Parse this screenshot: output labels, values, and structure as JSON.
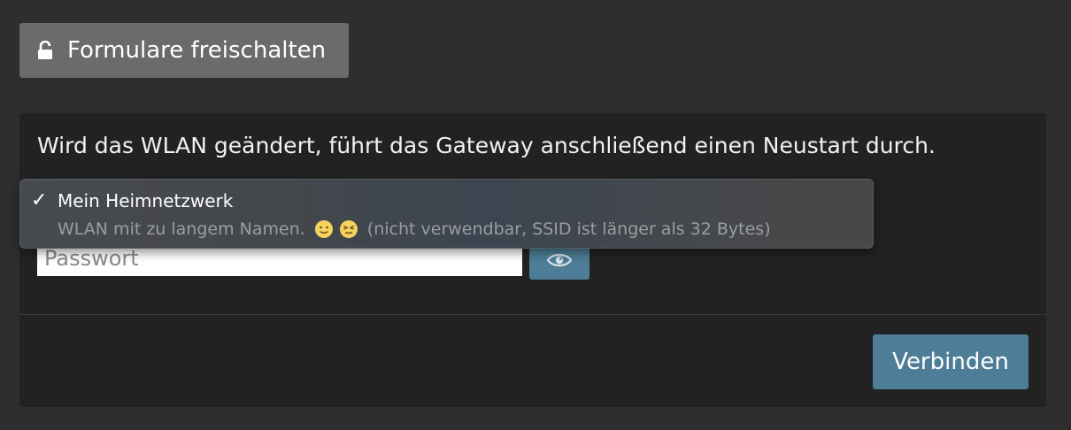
{
  "unlock_button": {
    "label": "Formulare freischalten",
    "icon": "unlock-icon"
  },
  "panel": {
    "info_text": "Wird das WLAN geändert, führt das Gateway anschließend einen Neustart durch.",
    "password": {
      "placeholder": "Passwort",
      "value": ""
    },
    "toggle_icon": "eye-icon",
    "connect_label": "Verbinden"
  },
  "dropdown": {
    "selected_option": {
      "check": "✓",
      "name": "Mein Heimnetzwerk",
      "desc_prefix": "WLAN mit zu langem Namen.",
      "emojis": [
        "slightly-smiling-face-emoji",
        "persevering-face-emoji"
      ],
      "desc_suffix": "(nicht verwendbar, SSID ist länger als 32 Bytes)"
    }
  },
  "colors": {
    "background": "#2e2e2e",
    "panel": "#222222",
    "unlock_button": "#6b6b6b",
    "accent": "#4e7d97"
  }
}
